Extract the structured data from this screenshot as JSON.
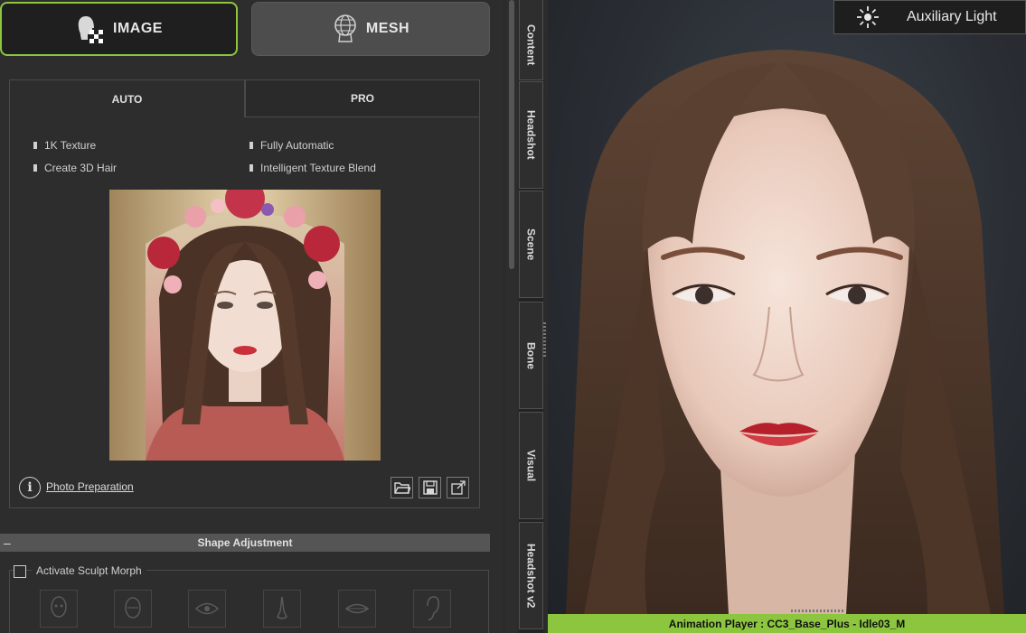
{
  "mode_buttons": {
    "image_label": "IMAGE",
    "mesh_label": "MESH"
  },
  "tabs": {
    "auto_label": "AUTO",
    "pro_label": "PRO"
  },
  "features": {
    "left": [
      "1K Texture",
      "Create 3D Hair"
    ],
    "right": [
      "Fully Automatic",
      "Intelligent Texture Blend"
    ]
  },
  "photo_preparation_link": "Photo Preparation",
  "shape_adjustment": {
    "title": "Shape Adjustment",
    "collapse_symbol": "–",
    "activate_label": "Activate Sculpt Morph"
  },
  "side_tabs": [
    "Content",
    "Headshot",
    "Scene",
    "Bone",
    "Visual",
    "Headshot v2"
  ],
  "viewport": {
    "aux_light_label": "Auxiliary Light",
    "animation_player": "Animation Player : CC3_Base_Plus - Idle03_M"
  },
  "colors": {
    "accent": "#8cc63f",
    "panel": "#2d2d2d",
    "tab_border": "#4a4a4a"
  }
}
